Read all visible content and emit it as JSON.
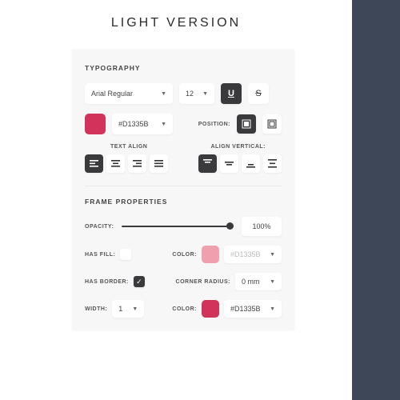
{
  "title": "LIGHT VERSION",
  "colors": {
    "accent": "#D1335B",
    "accent_light": "#F09FAF",
    "sidebar": "#3d4758",
    "dark": "#3a3a3d"
  },
  "typography": {
    "section": "TYPOGRAPHY",
    "font": "Arial Regular",
    "size": "12",
    "color_hex": "#D1335B",
    "position_label": "POSITION:",
    "text_align_label": "TEXT ALIGN",
    "align_vertical_label": "ALIGN VERTICAL:"
  },
  "frame": {
    "section": "FRAME PROPERTIES",
    "opacity_label": "OPACITY:",
    "opacity_value": "100%",
    "has_fill_label": "HAS FILL:",
    "fill_color_label": "COLOR:",
    "fill_color_hex": "#D1335B",
    "has_border_label": "HAS BORDER:",
    "corner_radius_label": "CORNER RADIUS:",
    "corner_radius_value": "0 mm",
    "width_label": "WIDTH:",
    "width_value": "1",
    "border_color_label": "COLOR:",
    "border_color_hex": "#D1335B"
  }
}
